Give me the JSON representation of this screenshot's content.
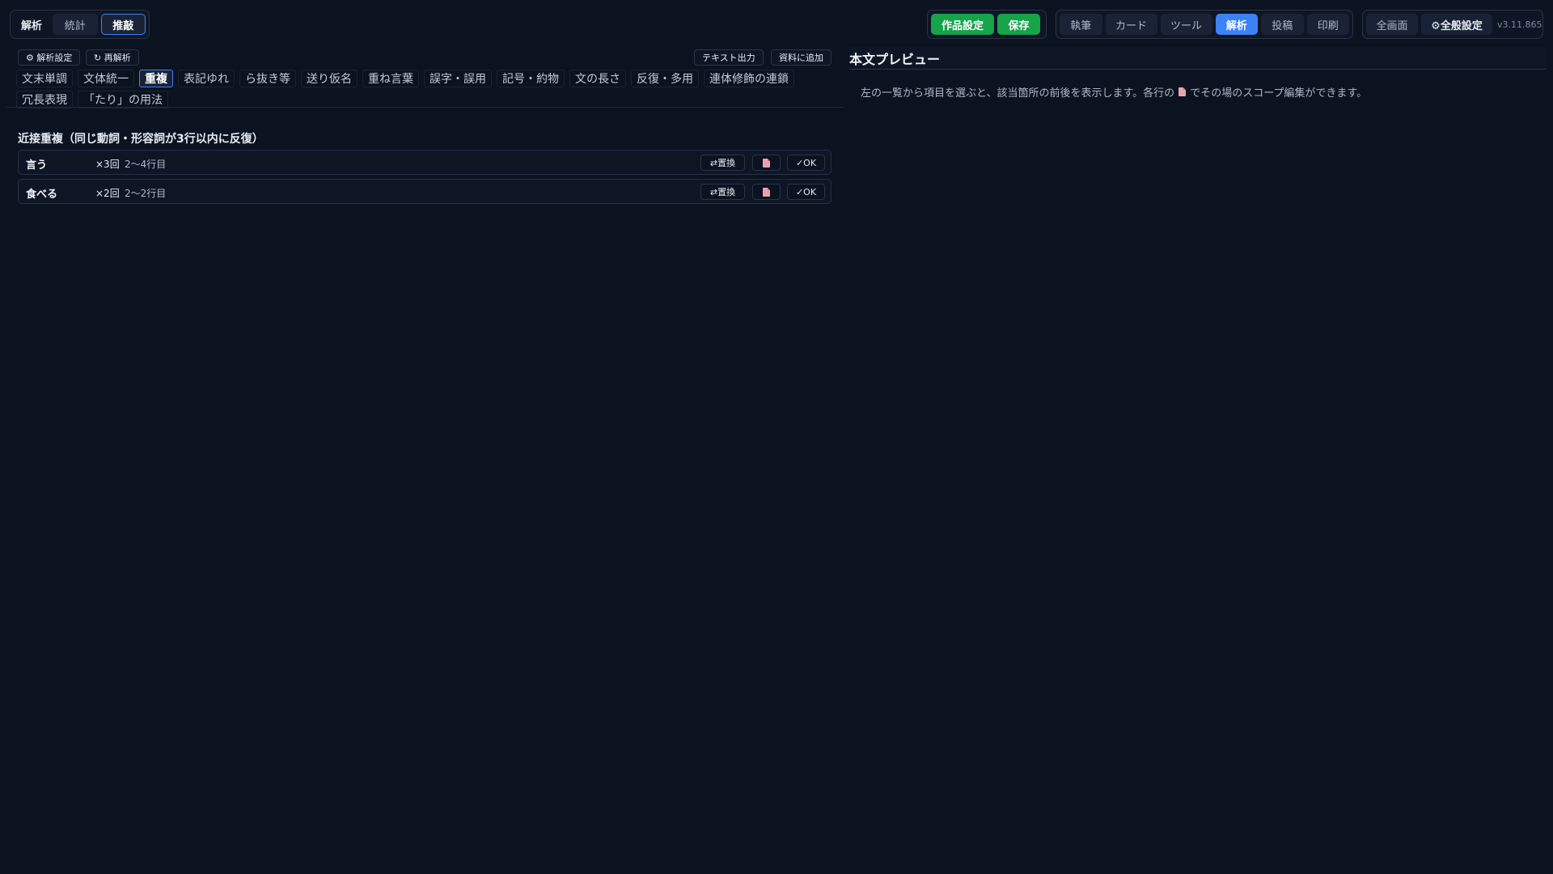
{
  "left_tabs": [
    {
      "label": "解析",
      "state": "plain"
    },
    {
      "label": "統計",
      "state": "normal"
    },
    {
      "label": "推敲",
      "state": "selected"
    }
  ],
  "project": {
    "settings_label": "作品設定",
    "save_label": "保存"
  },
  "mode_tabs": [
    {
      "label": "執筆",
      "active": false
    },
    {
      "label": "カード",
      "active": false
    },
    {
      "label": "ツール",
      "active": false
    },
    {
      "label": "解析",
      "active": true
    },
    {
      "label": "投稿",
      "active": false
    },
    {
      "label": "印刷",
      "active": false
    }
  ],
  "window": {
    "fullscreen_label": "全画面",
    "global_settings_label": "⚙全般設定",
    "version": "v3.11.865"
  },
  "analysis_toolbar": {
    "settings_label": "⚙ 解析設定",
    "reanalyze_label": "↻ 再解析",
    "export_label": "テキスト出力",
    "add_to_docs_label": "資料に追加"
  },
  "check_tabs": [
    {
      "label": "文末単調",
      "active": false
    },
    {
      "label": "文体統一",
      "active": false
    },
    {
      "label": "重複",
      "active": true
    },
    {
      "label": "表記ゆれ",
      "active": false
    },
    {
      "label": "ら抜き等",
      "active": false
    },
    {
      "label": "送り仮名",
      "active": false
    },
    {
      "label": "重ね言葉",
      "active": false
    },
    {
      "label": "誤字・誤用",
      "active": false
    },
    {
      "label": "記号・約物",
      "active": false
    },
    {
      "label": "文の長さ",
      "active": false
    },
    {
      "label": "反復・多用",
      "active": false
    },
    {
      "label": "連体修飾の連鎖",
      "active": false
    },
    {
      "label": "冗長表現",
      "active": false
    },
    {
      "label": "「たり」の用法",
      "active": false
    }
  ],
  "results": {
    "title": "近接重複（同じ動詞・形容詞が3行以内に反復）",
    "replace_label": "⇄置換",
    "ok_label": "✓OK",
    "items": [
      {
        "word": "言う",
        "count": "×3回",
        "lines": "2〜4行目"
      },
      {
        "word": "食べる",
        "count": "×2回",
        "lines": "2〜2行目"
      }
    ]
  },
  "preview": {
    "title": "本文プレビュー",
    "message_before": "左の一覧から項目を選ぶと、該当箇所の前後を表示します。各行の",
    "message_after": "でその場のスコープ編集ができます。"
  },
  "colors": {
    "background": "#0b1220",
    "accent_blue": "#3b82f6",
    "accent_green": "#16a34a"
  }
}
